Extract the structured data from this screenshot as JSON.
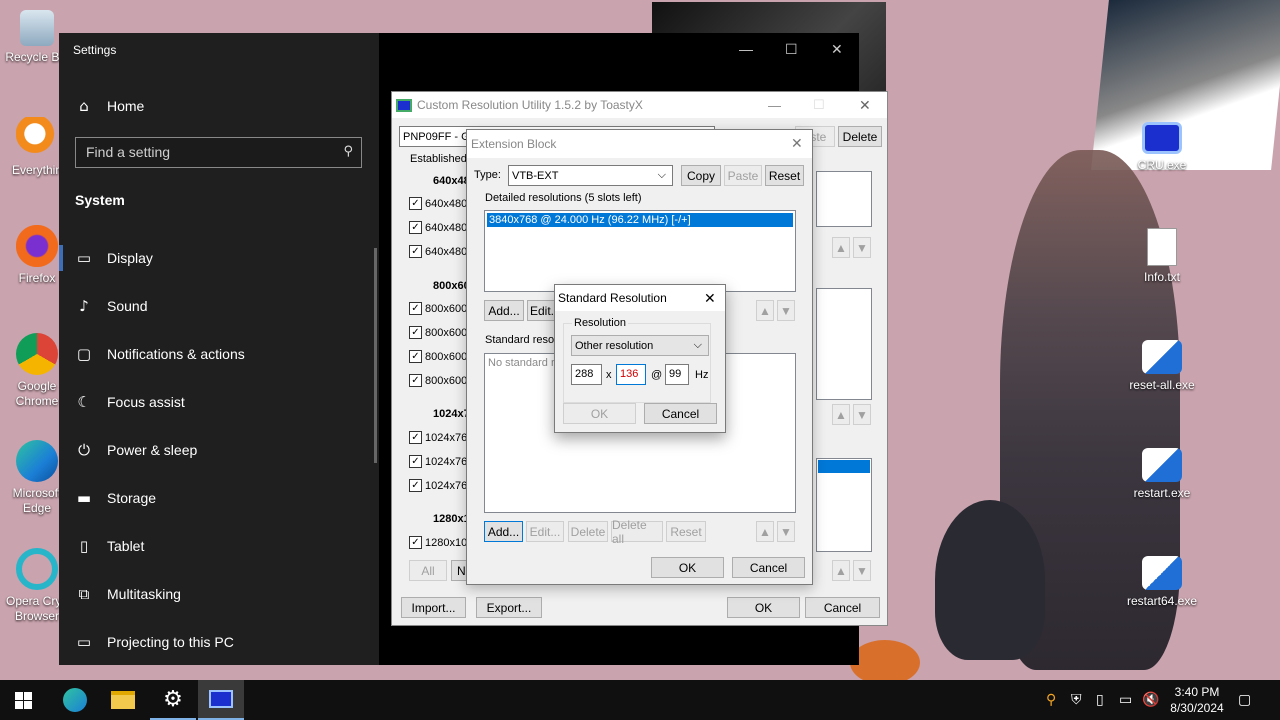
{
  "desktop": {
    "icons_left": [
      {
        "label": "Recycle Bin"
      },
      {
        "label": "Everythin"
      },
      {
        "label": "Firefox"
      },
      {
        "label": "Google Chrome"
      },
      {
        "label": "Microsoft Edge"
      },
      {
        "label": "Opera Cryp Browser"
      }
    ],
    "icons_right": [
      {
        "label": "CRU.exe"
      },
      {
        "label": "Info.txt"
      },
      {
        "label": "reset-all.exe"
      },
      {
        "label": "restart.exe"
      },
      {
        "label": "restart64.exe"
      }
    ]
  },
  "settings": {
    "title": "Settings",
    "home": "Home",
    "search_placeholder": "Find a setting",
    "section": "System",
    "items": [
      {
        "label": "Display",
        "icon": "monitor-icon"
      },
      {
        "label": "Sound",
        "icon": "speaker-icon"
      },
      {
        "label": "Notifications & actions",
        "icon": "notification-icon"
      },
      {
        "label": "Focus assist",
        "icon": "moon-icon"
      },
      {
        "label": "Power & sleep",
        "icon": "power-icon"
      },
      {
        "label": "Storage",
        "icon": "storage-icon"
      },
      {
        "label": "Tablet",
        "icon": "tablet-icon"
      },
      {
        "label": "Multitasking",
        "icon": "multitasking-icon"
      },
      {
        "label": "Projecting to this PC",
        "icon": "projecting-icon"
      }
    ]
  },
  "cru": {
    "title": "Custom Resolution Utility 1.5.2 by ToastyX",
    "monitor": "PNP09FF - Ge",
    "delete": "Delete",
    "paste": "aste",
    "established": "Established",
    "groups": [
      {
        "header": "640x48",
        "rows": [
          "640x480",
          "640x480",
          "640x480"
        ]
      },
      {
        "header": "800x60",
        "rows": [
          "800x600",
          "800x600",
          "800x600",
          "800x600"
        ]
      },
      {
        "header": "1024x7",
        "rows": [
          "1024x76",
          "1024x76",
          "1024x76"
        ]
      },
      {
        "header": "1280x1",
        "rows": [
          "1280x10"
        ]
      }
    ],
    "all": "All",
    "none_short": "N",
    "import": "Import...",
    "export": "Export...",
    "ok": "OK",
    "cancel": "Cancel"
  },
  "ext": {
    "title": "Extension Block",
    "type_label": "Type:",
    "type_value": "VTB-EXT",
    "copy": "Copy",
    "paste": "Paste",
    "reset": "Reset",
    "detailed_label": "Detailed resolutions (5 slots left)",
    "detailed_item": "3840x768 @ 24.000 Hz (96.22 MHz) [-/+]",
    "add": "Add...",
    "edit": "Edit...",
    "standard_label": "Standard reso",
    "standard_empty": "No standard r",
    "edit_dis": "Edit...",
    "delete": "Delete",
    "delete_all": "Delete all",
    "reset2": "Reset",
    "ok": "OK",
    "cancel": "Cancel"
  },
  "std": {
    "title": "Standard Resolution",
    "group": "Resolution",
    "select": "Other resolution",
    "width": "288",
    "height": "136",
    "x": "x",
    "at": "@",
    "refresh": "99",
    "hz": "Hz",
    "ok": "OK",
    "cancel": "Cancel"
  },
  "taskbar": {
    "time": "3:40 PM",
    "date": "8/30/2024"
  }
}
